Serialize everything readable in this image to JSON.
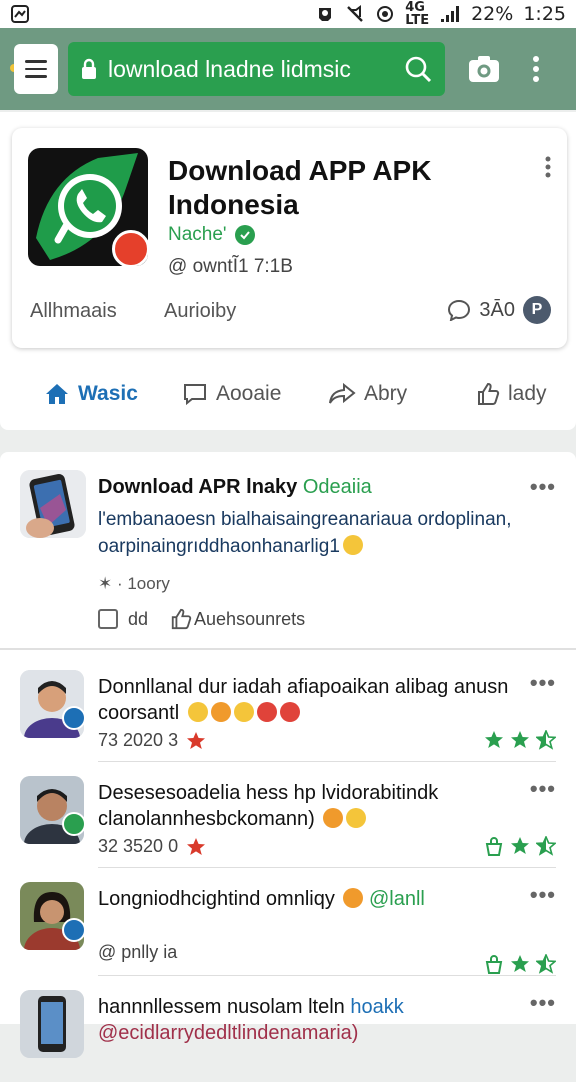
{
  "status_bar": {
    "battery": "22%",
    "time": "1:25"
  },
  "toolbar": {
    "url_text": "lownload lnadne lidmsic"
  },
  "app": {
    "title": "Download APP APK Indonesia",
    "developer": "Nache'",
    "owner": "@ owntĨ1 7:1B",
    "meta_left": "Allhmaais",
    "meta_mid": "Aurioiby",
    "likes": "3Ā0",
    "badge_letter": "P",
    "tabs": [
      {
        "label": "Wasic"
      },
      {
        "label": "Aooaie"
      },
      {
        "label": "Abry"
      },
      {
        "label": "lady"
      }
    ]
  },
  "feed": {
    "post": {
      "title": "Download APR lnaky",
      "title_green": "Odeaiia",
      "body": "l'embanaoesn bialhaisaingreanariaua ordoplinan, oarpinaingrıddhaonhanarlig1",
      "meta": "✶ · 1oory",
      "action1": "dd",
      "action2": "Auehsounrets"
    },
    "comments": [
      {
        "text": "Donnllanal dur iadah afiapoaikan alibag anusn coorsantl",
        "meta": "73 2020 3",
        "stars": [
          1,
          1,
          0.5
        ],
        "badge_color": "#1d6fb5"
      },
      {
        "text": "Desesesoadelia hess hp lvidorabitindk clanolannhesbckomann)",
        "meta": "32 3520 0",
        "stars": [
          0,
          1,
          0.5
        ],
        "badge_color": "#2a9f4f"
      },
      {
        "text": "Longniodhcightind omnliqy",
        "text_green": "@lanll",
        "meta": "@ pnlly ia",
        "stars": [
          0,
          1,
          0.5
        ],
        "badge_color": "#1d6fb5"
      },
      {
        "text": "hannnllessem nusolam lteln",
        "text_blue": "hoakk",
        "meta": "@ecidlarrydedltlindenamaria)"
      }
    ]
  },
  "colors": {
    "appbar": "#6f9a82",
    "url_bar": "#2a9f4f",
    "accent_blue": "#1d6fb5",
    "star_green": "#2a9f4f",
    "star_red": "#d93a2b"
  }
}
